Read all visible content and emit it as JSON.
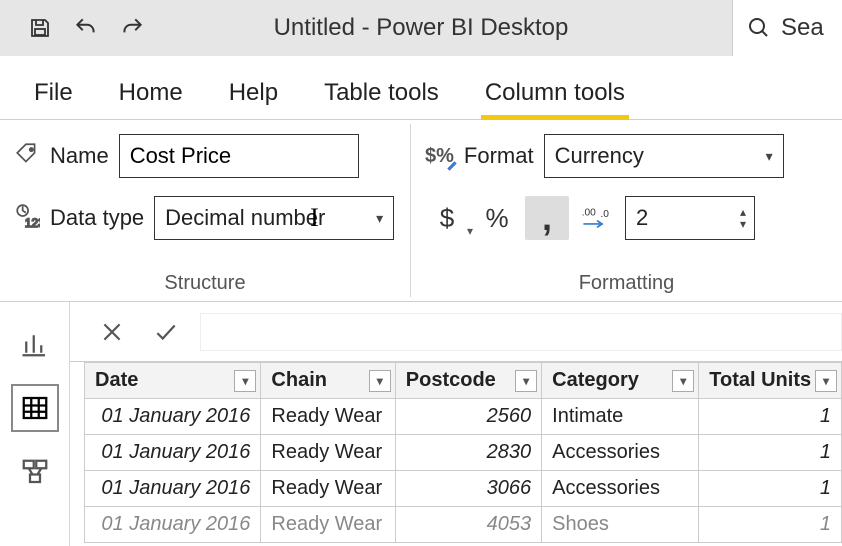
{
  "app_title": "Untitled - Power BI Desktop",
  "search_placeholder": "Sea",
  "tabs": {
    "file": "File",
    "home": "Home",
    "help": "Help",
    "table_tools": "Table tools",
    "column_tools": "Column tools"
  },
  "structure": {
    "name_label": "Name",
    "name_value": "Cost Price",
    "datatype_label": "Data type",
    "datatype_value": "Decimal number",
    "group_label": "Structure"
  },
  "formatting": {
    "format_label": "Format",
    "format_value": "Currency",
    "currency_glyph": "$",
    "percent_glyph": "%",
    "thousands_glyph": ",",
    "decimals_icon": ".00→.0",
    "decimal_places": "2",
    "group_label": "Formatting"
  },
  "views": {
    "report": "report-view",
    "data": "data-view",
    "model": "model-view"
  },
  "table": {
    "columns": [
      "Date",
      "Chain",
      "Postcode",
      "Category",
      "Total Units"
    ],
    "rows": [
      {
        "date": "01 January 2016",
        "chain": "Ready Wear",
        "postcode": "2560",
        "category": "Intimate",
        "total_units": "1"
      },
      {
        "date": "01 January 2016",
        "chain": "Ready Wear",
        "postcode": "2830",
        "category": "Accessories",
        "total_units": "1"
      },
      {
        "date": "01 January 2016",
        "chain": "Ready Wear",
        "postcode": "3066",
        "category": "Accessories",
        "total_units": "1"
      },
      {
        "date": "01 January 2016",
        "chain": "Ready Wear",
        "postcode": "4053",
        "category": "Shoes",
        "total_units": "1"
      }
    ]
  }
}
